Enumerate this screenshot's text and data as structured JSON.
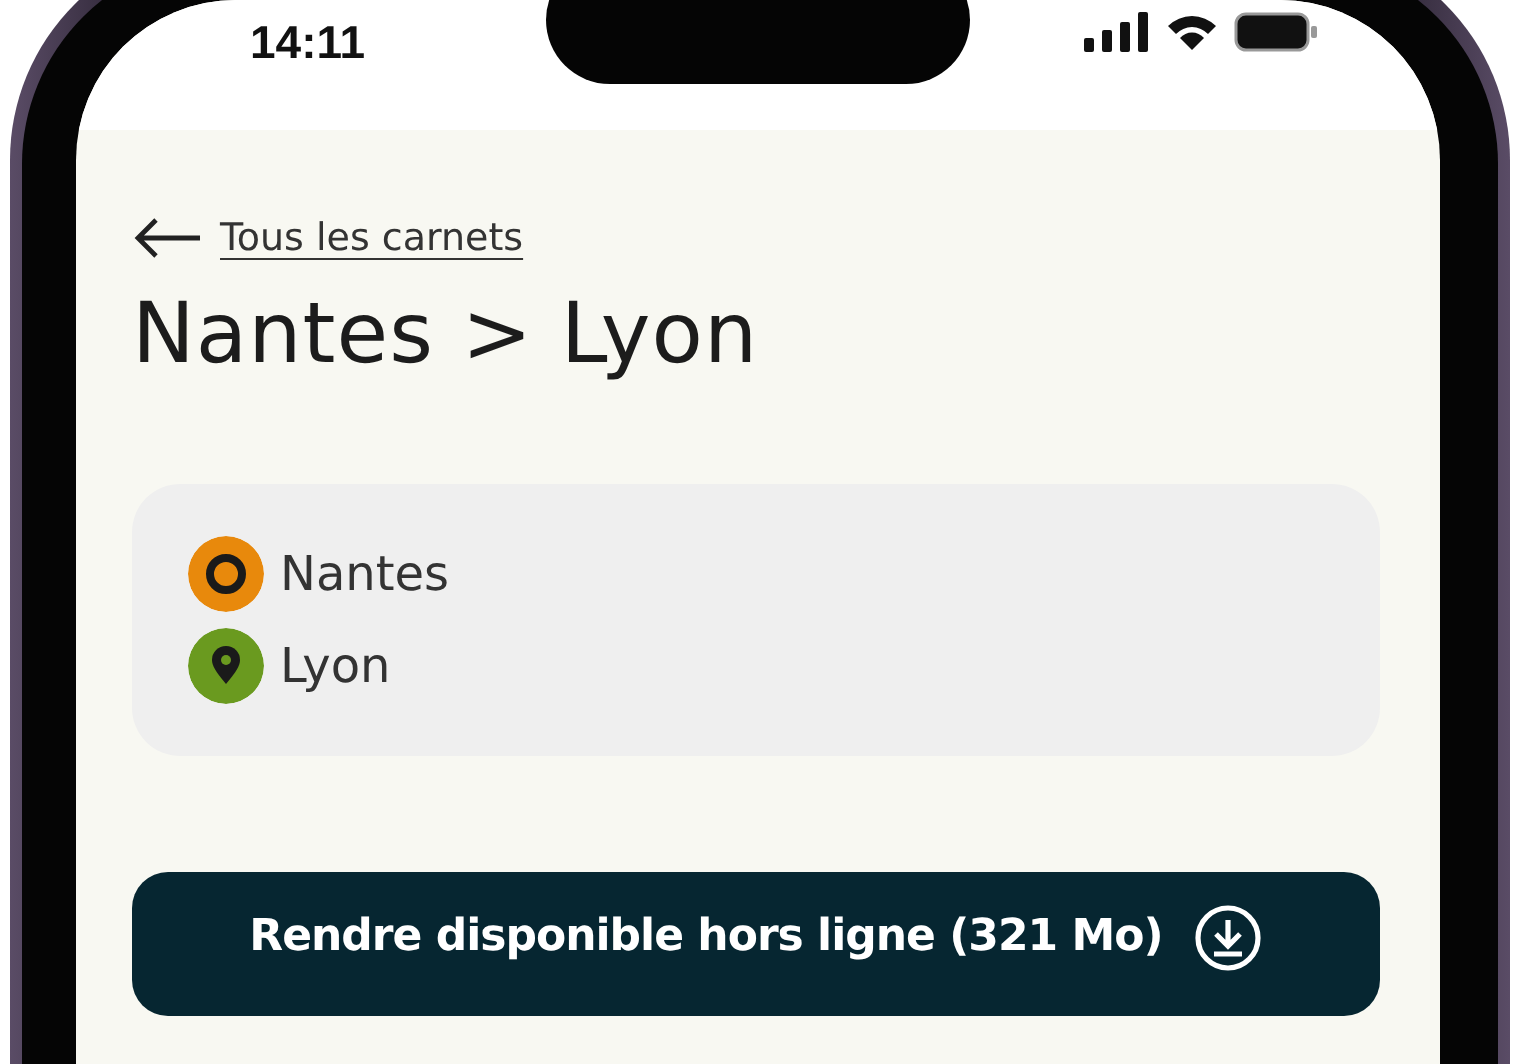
{
  "status_bar": {
    "time": "14:11"
  },
  "back_link": {
    "label": "Tous les carnets"
  },
  "title": "Nantes > Lyon",
  "stops": [
    {
      "kind": "origin",
      "label": "Nantes",
      "color": "#e8890c"
    },
    {
      "kind": "destination",
      "label": "Lyon",
      "color": "#6a9a1f"
    }
  ],
  "offline_button": {
    "label": "Rendre disponible hors ligne (321 Mo)"
  }
}
